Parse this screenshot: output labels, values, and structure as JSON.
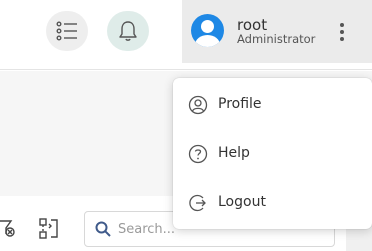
{
  "header": {
    "list_icon": "list-icon",
    "bell_icon": "bell-icon",
    "user": {
      "name": "root",
      "role": "Administrator",
      "avatar_icon": "user-avatar-icon",
      "menu_icon": "more-vertical-icon"
    }
  },
  "menu": {
    "items": [
      {
        "label": "Profile",
        "icon": "user-circle-icon"
      },
      {
        "label": "Help",
        "icon": "help-circle-icon"
      },
      {
        "label": "Logout",
        "icon": "logout-icon"
      }
    ]
  },
  "toolbar": {
    "filter_clear_icon": "filter-clear-icon",
    "switch_layout_icon": "switch-layout-icon",
    "search": {
      "placeholder": "Search...",
      "value": ""
    }
  },
  "colors": {
    "avatar": "#1e88e5",
    "bell_button_bg": "#dfece9",
    "user_chip_bg": "#ebebeb"
  }
}
